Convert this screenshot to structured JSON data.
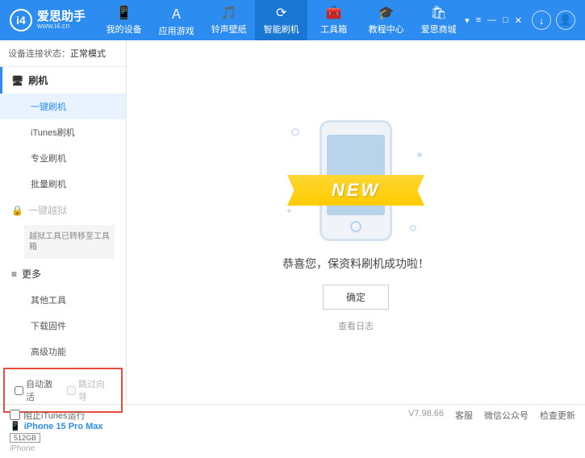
{
  "header": {
    "logo_text": "爱思助手",
    "logo_url": "www.i4.cn",
    "logo_badge": "i4",
    "nav": [
      {
        "icon": "📱",
        "label": "我的设备"
      },
      {
        "icon": "Ａ",
        "label": "应用游戏"
      },
      {
        "icon": "🎵",
        "label": "铃声壁纸"
      },
      {
        "icon": "⟳",
        "label": "智能刷机"
      },
      {
        "icon": "🧰",
        "label": "工具箱"
      },
      {
        "icon": "🎓",
        "label": "教程中心"
      },
      {
        "icon": "🛍",
        "label": "爱思商城"
      }
    ],
    "download_icon": "↓",
    "user_icon": "👤",
    "win_controls": [
      "▾",
      "≡",
      "—",
      "□",
      "✕"
    ]
  },
  "sidebar": {
    "status_label": "设备连接状态：",
    "status_value": "正常模式",
    "sections": {
      "flash": {
        "icon": "🖥",
        "label": "刷机"
      },
      "flash_items": [
        "一键刷机",
        "iTunes刷机",
        "专业刷机",
        "批量刷机"
      ],
      "jailbreak": {
        "icon": "🔒",
        "label": "一键越狱"
      },
      "jailbreak_note": "越狱工具已转移至工具箱",
      "more": {
        "icon": "≡",
        "label": "更多"
      },
      "more_items": [
        "其他工具",
        "下载固件",
        "高级功能"
      ]
    },
    "checkboxes": {
      "auto_activate": "自动激活",
      "skip_guide": "跳过向导"
    },
    "device": {
      "name": "iPhone 15 Pro Max",
      "storage": "512GB",
      "label": "iPhone"
    }
  },
  "main": {
    "ribbon": "NEW",
    "success_text": "恭喜您，保资料刷机成功啦！",
    "ok_button": "确定",
    "log_link": "查看日志"
  },
  "footer": {
    "block_itunes": "阻止iTunes运行",
    "version": "V7.98.66",
    "links": [
      "客服",
      "微信公众号",
      "检查更新"
    ]
  }
}
